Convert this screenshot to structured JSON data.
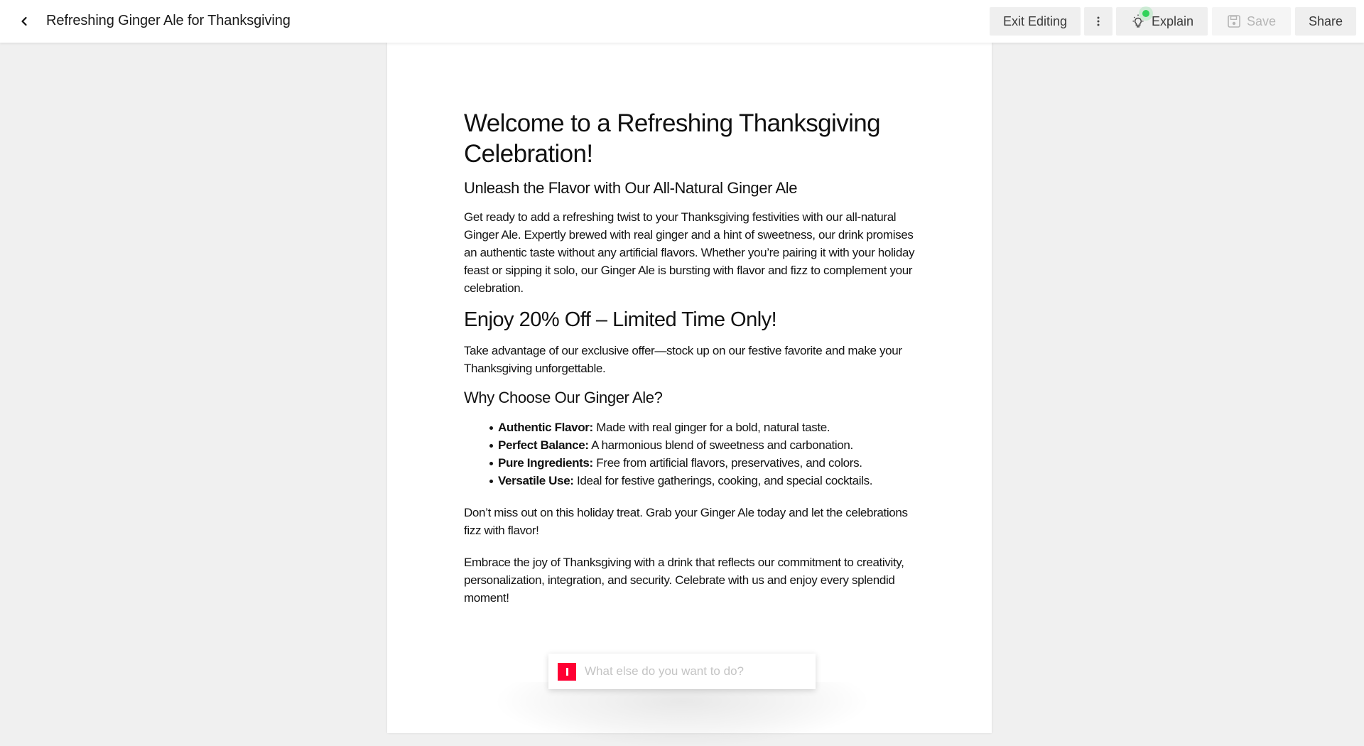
{
  "header": {
    "back_icon": "chevron-left-icon",
    "title": "Refreshing Ginger Ale for Thanksgiving",
    "toolbar": {
      "exit_editing_label": "Exit Editing",
      "more_icon": "vertical-dots-icon",
      "explain_label": "Explain",
      "explain_icon": "lightbulb-icon",
      "explain_notification": "green-dot",
      "save_label": "Save",
      "save_icon": "floppy-disk-icon",
      "save_disabled": true,
      "share_label": "Share"
    }
  },
  "document": {
    "title": "Welcome to a Refreshing Thanksgiving Celebration!",
    "subtitle": "Unleash the Flavor with Our All-Natural Ginger Ale",
    "intro": "Get ready to add a refreshing twist to your Thanksgiving festivities with our all-natural Ginger Ale. Expertly brewed with real ginger and a hint of sweetness, our drink promises an authentic taste without any artificial flavors. Whether you’re pairing it with your holiday feast or sipping it solo, our Ginger Ale is bursting with flavor and fizz to complement your celebration.",
    "offer_heading": "Enjoy 20% Off – Limited Time Only!",
    "offer_text": "Take advantage of our exclusive offer—stock up on our festive favorite and make your Thanksgiving unforgettable.",
    "why_heading": "Why Choose Our Ginger Ale?",
    "features": [
      {
        "label": "Authentic Flavor:",
        "text": " Made with real ginger for a bold, natural taste."
      },
      {
        "label": "Perfect Balance:",
        "text": " A harmonious blend of sweetness and carbonation."
      },
      {
        "label": "Pure Ingredients:",
        "text": " Free from artificial flavors, preservatives, and colors."
      },
      {
        "label": "Versatile Use:",
        "text": " Ideal for festive gatherings, cooking, and special cocktails."
      }
    ],
    "cta_text": "Don’t miss out on this holiday treat. Grab your Ginger Ale today and let the celebrations fizz with flavor!",
    "closing_text": "Embrace the joy of Thanksgiving with a drink that reflects our commitment to creativity, personalization, integration, and security. Celebrate with us and enjoy every splendid moment!"
  },
  "prompt": {
    "value": "",
    "placeholder": "What else do you want to do?",
    "brand_color": "#ff0033"
  },
  "colors": {
    "background": "#f0f0f0",
    "paper": "#ffffff",
    "button_bg": "#efefef",
    "notification_green": "#2fd35a"
  }
}
